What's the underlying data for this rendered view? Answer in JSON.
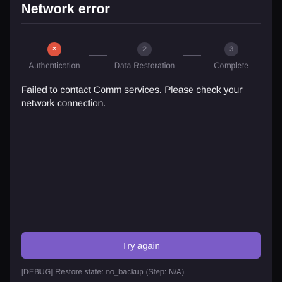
{
  "header": {
    "title": "Network error"
  },
  "steps": [
    {
      "label": "Authentication",
      "marker": "×",
      "status": "error"
    },
    {
      "label": "Data Restoration",
      "marker": "2",
      "status": "pending"
    },
    {
      "label": "Complete",
      "marker": "3",
      "status": "pending"
    }
  ],
  "message": "Failed to contact Comm services. Please check your network connection.",
  "actions": {
    "try_again_label": "Try again"
  },
  "debug": {
    "text": "[DEBUG] Restore state: no_backup (Step: N/A)"
  },
  "colors": {
    "background": "#1d1b26",
    "error": "#e0533f",
    "primary_button": "#7b5cc7",
    "muted_text": "#8c8a98"
  }
}
